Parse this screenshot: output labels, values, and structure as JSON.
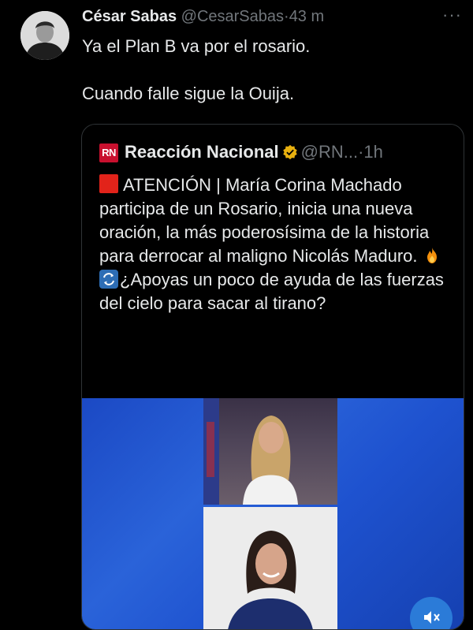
{
  "tweet": {
    "author_name": "César Sabas",
    "handle": "@CesarSabas",
    "separator": "·",
    "time": "43 m",
    "more_label": "···",
    "paragraphs": [
      "Ya el Plan B va por el rosario.",
      "Cuando falle sigue la Ouija."
    ]
  },
  "quoted_tweet": {
    "logo_text": "RN",
    "author_name": "Reacción Nacional",
    "verified_icon": "verified-badge-gold",
    "handle": "@RN...",
    "separator": "·",
    "time": "1h",
    "text_main": "ATENCIÓN | María Corina Machado participa de un Rosario, inicia una nueva oración, la más poderosísima de la historia para derrocar al maligno Nicolás Maduro.",
    "text_tail": "¿Apoyas un poco de ayuda de las fuerzas del cielo para sacar al tirano?",
    "icons": [
      "red-square-icon",
      "fire-icon",
      "repeat-icon"
    ]
  },
  "media": {
    "type": "video",
    "mute_icon": "speaker-muted-icon"
  },
  "colors": {
    "background": "#000000",
    "text": "#e7e9ea",
    "muted": "#71767b",
    "border": "#2f3336",
    "video_blue": "#2a63d9",
    "rn_red": "#c8102e"
  }
}
